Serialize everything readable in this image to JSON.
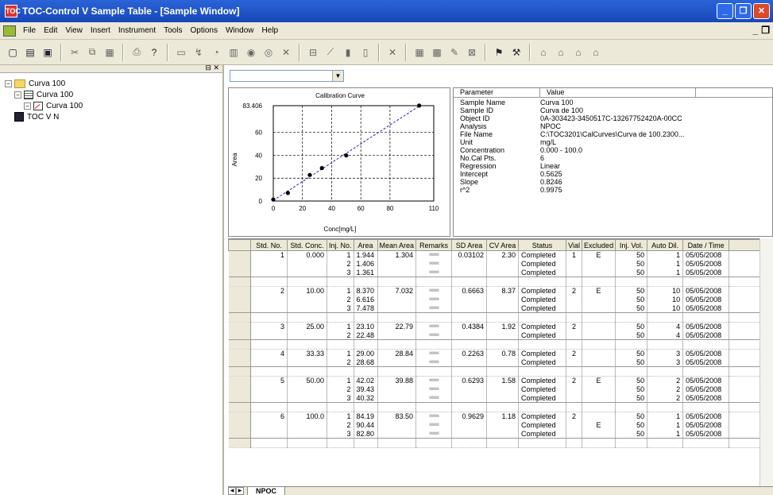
{
  "window": {
    "title": "TOC-Control V Sample Table - [Sample Window]",
    "app_icon": "TOC"
  },
  "menu": [
    "File",
    "Edit",
    "View",
    "Insert",
    "Instrument",
    "Tools",
    "Options",
    "Window",
    "Help"
  ],
  "tree": {
    "root": "Curva 100",
    "table": "Curva 100",
    "chart": "Curva 100",
    "instrument": "TOC V N"
  },
  "dropdown_value": "",
  "chart_data": {
    "type": "scatter",
    "title": "Calibration Curve",
    "xlabel": "Conc[mg/L]",
    "ylabel": "Area",
    "x_ticks": [
      "0",
      "20",
      "40",
      "60",
      "80",
      "110"
    ],
    "y_ticks": [
      "0",
      "20",
      "40",
      "60",
      "83.406"
    ],
    "xlim": [
      0,
      110
    ],
    "ylim": [
      0,
      83.406
    ],
    "points": [
      {
        "x": 0,
        "y": 1.304
      },
      {
        "x": 10,
        "y": 7.032
      },
      {
        "x": 25,
        "y": 22.79
      },
      {
        "x": 33.33,
        "y": 28.84
      },
      {
        "x": 50,
        "y": 39.88
      },
      {
        "x": 100,
        "y": 83.5
      }
    ],
    "fit_line": {
      "slope": 0.8246,
      "intercept": 0.5625
    }
  },
  "properties": {
    "headers": [
      "Parameter",
      "Value"
    ],
    "rows": [
      {
        "k": "Sample Name",
        "v": "Curva 100"
      },
      {
        "k": "Sample ID",
        "v": "Curva de 100"
      },
      {
        "k": "Object ID",
        "v": "0A-303423-3450517C-13267752420A-00CC"
      },
      {
        "k": "Analysis",
        "v": "NPOC"
      },
      {
        "k": "File Name",
        "v": "C:\\TOC3201\\CalCurves\\Curva de 100.2300..."
      },
      {
        "k": "Unit",
        "v": "mg/L"
      },
      {
        "k": "Concentration",
        "v": "0.000 - 100.0"
      },
      {
        "k": "No.Cal Pts.",
        "v": "6"
      },
      {
        "k": "Regression",
        "v": "Linear"
      },
      {
        "k": "Intercept",
        "v": "0.5625"
      },
      {
        "k": "Slope",
        "v": "0.8246"
      },
      {
        "k": "r^2",
        "v": "0.9975"
      }
    ]
  },
  "grid": {
    "headers": [
      "Std. No.",
      "Std. Conc.",
      "Inj. No.",
      "Area",
      "Mean Area",
      "Remarks",
      "SD Area",
      "CV Area",
      "Status",
      "Vial",
      "Excluded",
      "Inj. Vol.",
      "Auto Dil.",
      "Date / Time"
    ],
    "groups": [
      {
        "std": "1",
        "conc": "0.000",
        "mean": "1.304",
        "sd": "0.03102",
        "cv": "2.30",
        "vial": "1",
        "rows": [
          {
            "inj": "1",
            "area": "1.944",
            "status": "Completed",
            "excl": "E",
            "vol": "50",
            "dil": "1",
            "date": "05/05/2008"
          },
          {
            "inj": "2",
            "area": "1.406",
            "status": "Completed",
            "excl": "",
            "vol": "50",
            "dil": "1",
            "date": "05/05/2008"
          },
          {
            "inj": "3",
            "area": "1.361",
            "status": "Completed",
            "excl": "",
            "vol": "50",
            "dil": "1",
            "date": "05/05/2008"
          }
        ]
      },
      {
        "std": "2",
        "conc": "10.00",
        "mean": "7.032",
        "sd": "0.6663",
        "cv": "8.37",
        "vial": "2",
        "rows": [
          {
            "inj": "1",
            "area": "8.370",
            "status": "Completed",
            "excl": "E",
            "vol": "50",
            "dil": "10",
            "date": "05/05/2008"
          },
          {
            "inj": "2",
            "area": "6.616",
            "status": "Completed",
            "excl": "",
            "vol": "50",
            "dil": "10",
            "date": "05/05/2008"
          },
          {
            "inj": "3",
            "area": "7.478",
            "status": "Completed",
            "excl": "",
            "vol": "50",
            "dil": "10",
            "date": "05/05/2008"
          }
        ]
      },
      {
        "std": "3",
        "conc": "25.00",
        "mean": "22.79",
        "sd": "0.4384",
        "cv": "1.92",
        "vial": "2",
        "rows": [
          {
            "inj": "1",
            "area": "23.10",
            "status": "Completed",
            "excl": "",
            "vol": "50",
            "dil": "4",
            "date": "05/05/2008"
          },
          {
            "inj": "2",
            "area": "22.48",
            "status": "Completed",
            "excl": "",
            "vol": "50",
            "dil": "4",
            "date": "05/05/2008"
          }
        ]
      },
      {
        "std": "4",
        "conc": "33.33",
        "mean": "28.84",
        "sd": "0.2263",
        "cv": "0.78",
        "vial": "2",
        "rows": [
          {
            "inj": "1",
            "area": "29.00",
            "status": "Completed",
            "excl": "",
            "vol": "50",
            "dil": "3",
            "date": "05/05/2008"
          },
          {
            "inj": "2",
            "area": "28.68",
            "status": "Completed",
            "excl": "",
            "vol": "50",
            "dil": "3",
            "date": "05/05/2008"
          }
        ]
      },
      {
        "std": "5",
        "conc": "50.00",
        "mean": "39.88",
        "sd": "0.6293",
        "cv": "1.58",
        "vial": "2",
        "rows": [
          {
            "inj": "1",
            "area": "42.02",
            "status": "Completed",
            "excl": "E",
            "vol": "50",
            "dil": "2",
            "date": "05/05/2008"
          },
          {
            "inj": "2",
            "area": "39.43",
            "status": "Completed",
            "excl": "",
            "vol": "50",
            "dil": "2",
            "date": "05/05/2008"
          },
          {
            "inj": "3",
            "area": "40.32",
            "status": "Completed",
            "excl": "",
            "vol": "50",
            "dil": "2",
            "date": "05/05/2008"
          }
        ]
      },
      {
        "std": "6",
        "conc": "100.0",
        "mean": "83.50",
        "sd": "0.9629",
        "cv": "1.18",
        "vial": "2",
        "rows": [
          {
            "inj": "1",
            "area": "84.19",
            "status": "Completed",
            "excl": "",
            "vol": "50",
            "dil": "1",
            "date": "05/05/2008"
          },
          {
            "inj": "2",
            "area": "90.44",
            "status": "Completed",
            "excl": "E",
            "vol": "50",
            "dil": "1",
            "date": "05/05/2008"
          },
          {
            "inj": "3",
            "area": "82.80",
            "status": "Completed",
            "excl": "",
            "vol": "50",
            "dil": "1",
            "date": "05/05/2008"
          }
        ]
      }
    ]
  },
  "bottom_tab": "NPOC",
  "remarks_mark": "xxxxxx"
}
